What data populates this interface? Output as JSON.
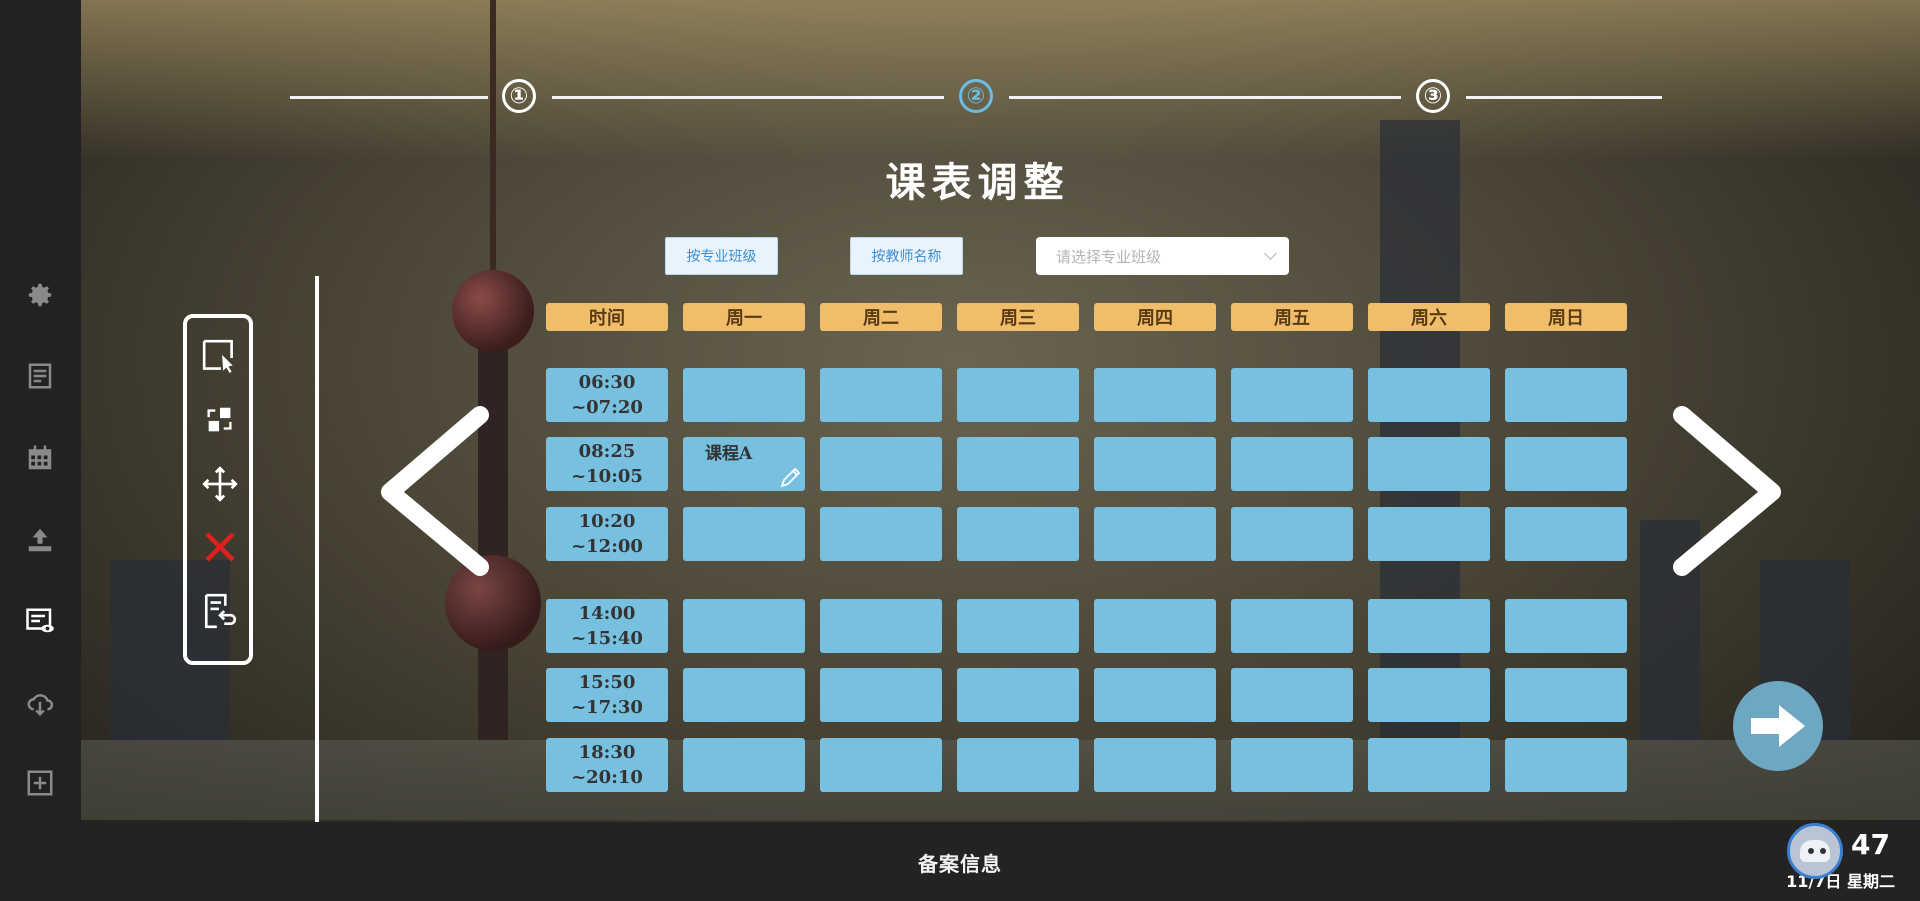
{
  "stepper": {
    "steps": [
      "①",
      "②",
      "③"
    ],
    "active_index": 1
  },
  "page": {
    "title": "课表调整"
  },
  "filters": {
    "by_major_class": "按专业班级",
    "by_teacher_name": "按教师名称",
    "select_placeholder": "请选择专业班级"
  },
  "schedule": {
    "header_time": "时间",
    "days": [
      "周一",
      "周二",
      "周三",
      "周四",
      "周五",
      "周六",
      "周日"
    ],
    "time_slots": [
      {
        "start": "06:30",
        "end": "~07:20"
      },
      {
        "start": "08:25",
        "end": "~10:05"
      },
      {
        "start": "10:20",
        "end": "~12:00"
      },
      {
        "start": "14:00",
        "end": "~15:40"
      },
      {
        "start": "15:50",
        "end": "~17:30"
      },
      {
        "start": "18:30",
        "end": "~20:10"
      }
    ],
    "course_a": "课程A"
  },
  "toolbar_icons": [
    "select-icon",
    "swap-icon",
    "move-icon",
    "delete-icon",
    "undo-icon"
  ],
  "sidebar_icons": [
    "settings-icon",
    "notes-icon",
    "calendar-icon",
    "upload-icon",
    "schedule-view-icon",
    "cloud-icon",
    "add-icon",
    "home-icon"
  ],
  "footer": {
    "record_info": "备案信息",
    "time": "47",
    "date": "11/7日 星期二"
  },
  "colors": {
    "cell": "#77c0e0",
    "header": "#f0bd6b",
    "active_step": "#6bbde4"
  }
}
